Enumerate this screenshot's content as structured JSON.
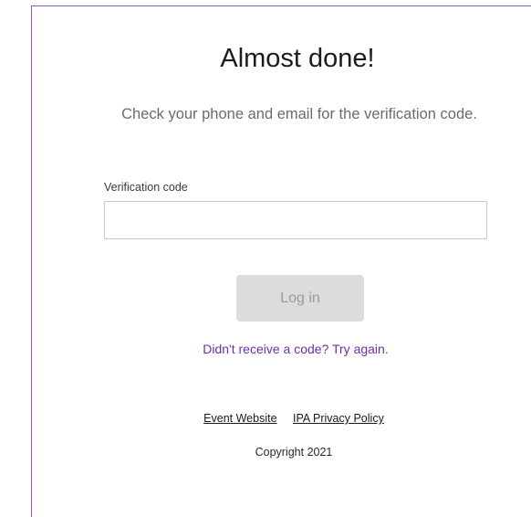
{
  "heading": "Almost done!",
  "instructions": "Check your phone and email for the verification code.",
  "form": {
    "code_label": "Verification code",
    "code_value": "",
    "login_label": "Log in"
  },
  "retry_link": "Didn't receive a code? Try again.",
  "footer": {
    "links": [
      "Event Website",
      "IPA Privacy Policy"
    ],
    "copyright": "Copyright 2021"
  },
  "colors": {
    "accent": "#6b2fa8",
    "frame_border": "#8a5bb0",
    "button_disabled_bg": "#dcdcdc"
  }
}
